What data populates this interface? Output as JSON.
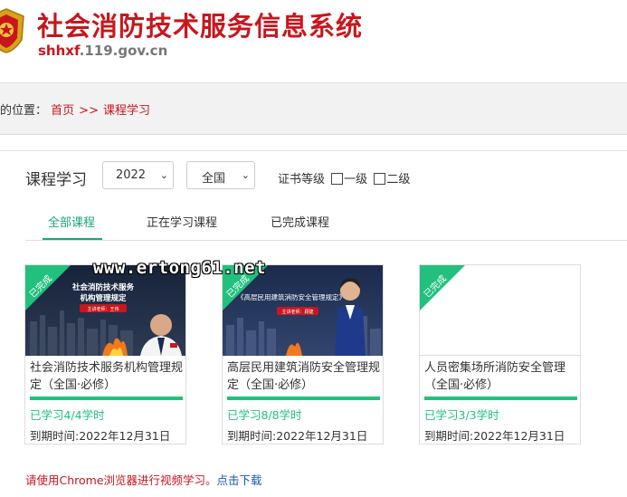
{
  "site": {
    "title": "社会消防技术服务信息系统",
    "domain_highlight": "shhxf",
    "domain_rest": ".119.gov.cn"
  },
  "breadcrumb": {
    "prefix": "的位置：",
    "home": "首页",
    "separator": ">>",
    "current": "课程学习"
  },
  "filters": {
    "section_title": "课程学习",
    "year_value": "2022",
    "region_value": "全国",
    "cert_label": "证书等级",
    "level1_label": "一级",
    "level2_label": "二级"
  },
  "tabs": [
    {
      "label": "全部课程",
      "active": true
    },
    {
      "label": "正在学习课程",
      "active": false
    },
    {
      "label": "已完成课程",
      "active": false
    }
  ],
  "courses": [
    {
      "badge": "已完成",
      "title": "社会消防技术服务机构管理规定（全国·必修）",
      "progress": 1.0,
      "hours": "已学习4/4学时",
      "due": "到期时间:2022年12月31日",
      "thumb_title1": "社会消防技术服务",
      "thumb_title2": "机构管理规定",
      "thumb_host": "主讲老师：王伟"
    },
    {
      "badge": "已完成",
      "title": "高层民用建筑消防安全管理规定（全国·必修）",
      "progress": 1.0,
      "hours": "已学习8/8学时",
      "due": "到期时间:2022年12月31日",
      "thumb_title1": "《高层民用建筑消防安全管理规定》",
      "thumb_host": "主讲老师：顾建"
    },
    {
      "badge": "已完成",
      "title": "人员密集场所消防安全管理（全国·必修）",
      "progress": 1.0,
      "hours": "已学习3/3学时",
      "due": "到期时间:2022年12月31日"
    }
  ],
  "footer": {
    "note": "请使用Chrome浏览器进行视频学习。",
    "download": "点击下载"
  },
  "watermark": "www.ertong61.net",
  "colors": {
    "brand_red": "#c8161d",
    "accent_green": "#22c07d",
    "link_blue": "#1a55b4"
  }
}
